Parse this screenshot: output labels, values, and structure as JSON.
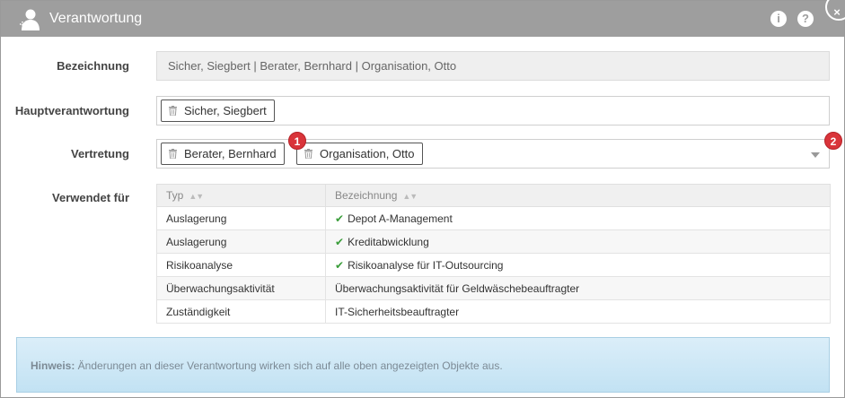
{
  "dialog": {
    "title": "Verantwortung",
    "info_label": "i",
    "help_label": "?",
    "close_label": "×"
  },
  "form": {
    "bezeichnung_label": "Bezeichnung",
    "bezeichnung_value": "Sicher, Siegbert | Berater, Bernhard | Organisation, Otto",
    "haupt_label": "Hauptverantwortung",
    "haupt_tags": [
      "Sicher, Siegbert"
    ],
    "vertretung_label": "Vertretung",
    "vertretung_tags": [
      "Berater, Bernhard",
      "Organisation, Otto"
    ],
    "verwendet_label": "Verwendet für"
  },
  "badges": [
    "1",
    "2"
  ],
  "table": {
    "columns": [
      "Typ",
      "Bezeichnung"
    ],
    "rows": [
      {
        "typ": "Auslagerung",
        "bezeichnung": "Depot A-Management",
        "checked": true
      },
      {
        "typ": "Auslagerung",
        "bezeichnung": "Kreditabwicklung",
        "checked": true
      },
      {
        "typ": "Risikoanalyse",
        "bezeichnung": "Risikoanalyse für IT-Outsourcing",
        "checked": true
      },
      {
        "typ": "Überwachungsaktivität",
        "bezeichnung": "Überwachungsaktivität für Geldwäschebeauftragter",
        "checked": false
      },
      {
        "typ": "Zuständigkeit",
        "bezeichnung": "IT-Sicherheitsbeauftragter",
        "checked": false
      }
    ]
  },
  "hint": {
    "label": "Hinweis:",
    "text": " Änderungen an dieser Verantwortung wirken sich auf alle oben angezeigten Objekte aus."
  },
  "colors": {
    "titlebar": "#9e9e9e",
    "badge": "#d9343a",
    "check": "#3a9d3a",
    "hint_bg": "#c2e2f3"
  },
  "icons": [
    "user-responsibility-icon",
    "info-icon",
    "help-icon",
    "close-icon",
    "trash-icon",
    "caret-down-icon",
    "sort-icon",
    "check-icon"
  ]
}
